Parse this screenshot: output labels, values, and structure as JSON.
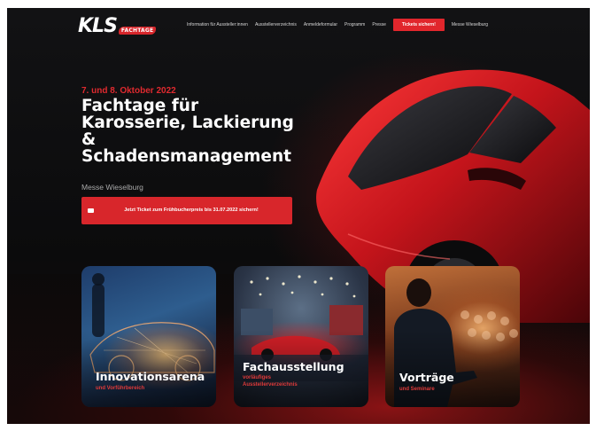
{
  "logo": {
    "text": "KLS",
    "badge": "FACHTAGE"
  },
  "nav": {
    "items": [
      "Information für Aussteller:innen",
      "Ausstellerverzeichnis",
      "Anmeldeformular",
      "Programm",
      "Presse"
    ],
    "cta": "Tickets sichern!",
    "last_item": "Messe Wieselburg"
  },
  "hero": {
    "date": "7. und 8. Oktober 2022",
    "title_lines": [
      "Fachtage für",
      "Karosserie, Lackierung",
      "&",
      "Schadensmanagement"
    ],
    "venue": "Messe Wieselburg",
    "cta_label": "Jetzt Ticket zum Frühbucherpreis bis 31.07.2022 sichern!",
    "cta_icon": "ticket-icon"
  },
  "cards": [
    {
      "title": "Innovationsarena",
      "sub_lines": [
        "und Vorführbereich"
      ]
    },
    {
      "title": "Fachausstellung",
      "sub_lines": [
        "vorläufiges",
        "Ausstellerverzeichnis"
      ]
    },
    {
      "title": "Vorträge",
      "sub_lines": [
        "und Seminare"
      ]
    }
  ],
  "colors": {
    "accent": "#e1262c",
    "background": "#0d0d0f",
    "text": "#ffffff"
  }
}
